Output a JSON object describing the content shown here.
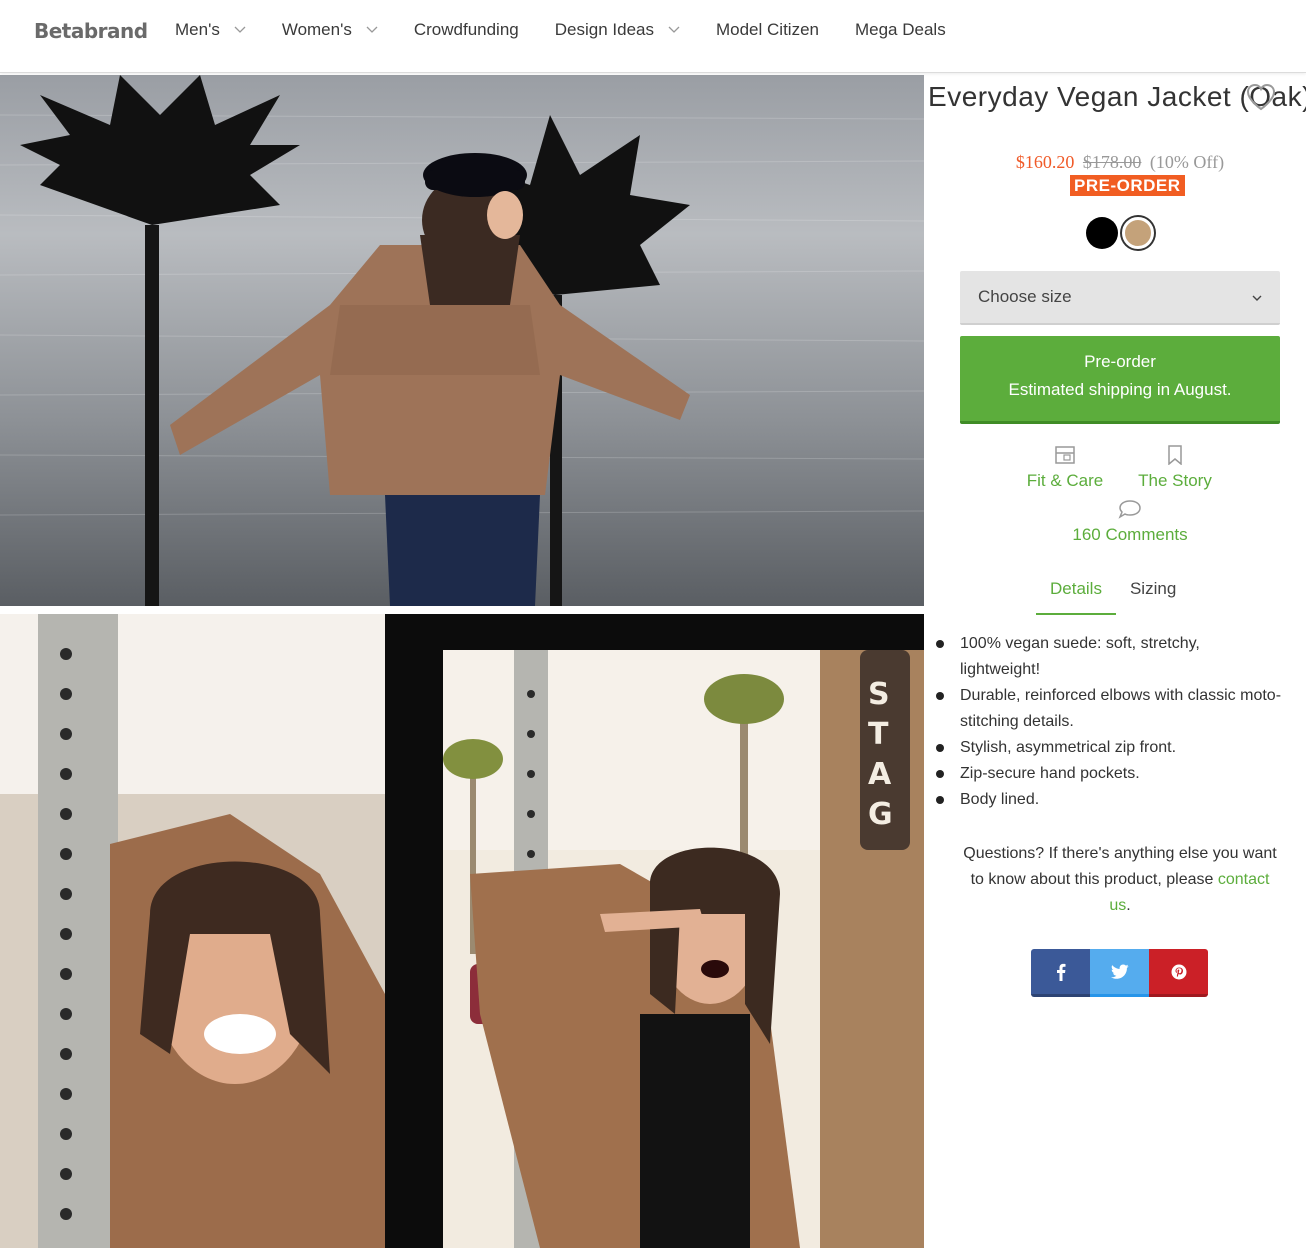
{
  "header": {
    "logo": "Betabrand",
    "nav": [
      {
        "label": "Men's",
        "has_dropdown": true
      },
      {
        "label": "Women's",
        "has_dropdown": true
      },
      {
        "label": "Crowdfunding",
        "has_dropdown": false
      },
      {
        "label": "Design Ideas",
        "has_dropdown": true
      },
      {
        "label": "Model Citizen",
        "has_dropdown": false
      },
      {
        "label": "Mega Deals",
        "has_dropdown": false
      }
    ]
  },
  "product": {
    "title": "Everyday Vegan Jacket (Oak)",
    "price_sale": "$160.20",
    "price_original": "$178.00",
    "discount": "(10% Off)",
    "badge": "PRE-ORDER",
    "swatches": [
      {
        "name": "Black",
        "color": "#000000"
      },
      {
        "name": "Oak",
        "color": "#c4a27a",
        "selected": true
      }
    ],
    "size_placeholder": "Choose size",
    "preorder_line1": "Pre-order",
    "preorder_line2": "Estimated shipping in August."
  },
  "links": {
    "fit_care": "Fit & Care",
    "story": "The Story",
    "comments": "160 Comments"
  },
  "tabs": [
    "Details",
    "Sizing"
  ],
  "details": [
    "100% vegan suede: soft, stretchy, lightweight!",
    "Durable, reinforced elbows with classic moto-stitching details.",
    "Stylish, asymmetrical zip front.",
    "Zip-secure hand pockets.",
    "Body lined."
  ],
  "questions": {
    "text_before": "Questions? If there's anything else you want to know about this product, please ",
    "link": "contact us",
    "text_after": "."
  },
  "colors": {
    "accent_green": "#5cad3c",
    "sale_orange": "#f05a28",
    "facebook": "#3b5998",
    "twitter": "#55acee",
    "pinterest": "#cb2027"
  }
}
